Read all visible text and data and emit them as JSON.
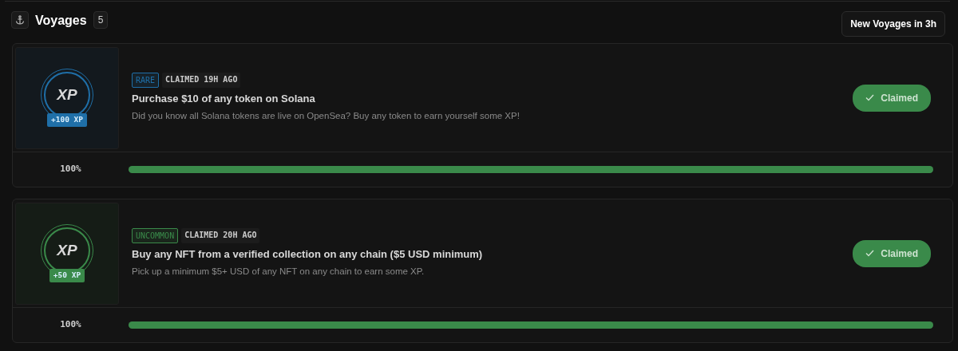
{
  "header": {
    "title": "Voyages",
    "count": "5",
    "button": "New Voyages in 3h"
  },
  "voyages": [
    {
      "color": "#1f6fa8",
      "coin_label": "XP",
      "reward": "+100 XP",
      "rarity": "RARE",
      "claimed_time": "CLAIMED 19H AGO",
      "title": "Purchase $10 of any token on Solana",
      "description": "Did you know all Solana tokens are live on OpenSea? Buy any token to earn yourself some XP!",
      "button": "Claimed",
      "reading": "100%",
      "level": 1.0
    },
    {
      "color": "#3a8a4a",
      "coin_label": "XP",
      "reward": "+50 XP",
      "rarity": "UNCOMMON",
      "claimed_time": "CLAIMED 20H AGO",
      "title": "Buy any NFT from a verified collection on any chain ($5 USD minimum)",
      "description": "Pick up a minimum $5+ USD of any NFT on any chain to earn some XP.",
      "button": "Claimed",
      "reading": "100%",
      "level": 1.0
    }
  ]
}
